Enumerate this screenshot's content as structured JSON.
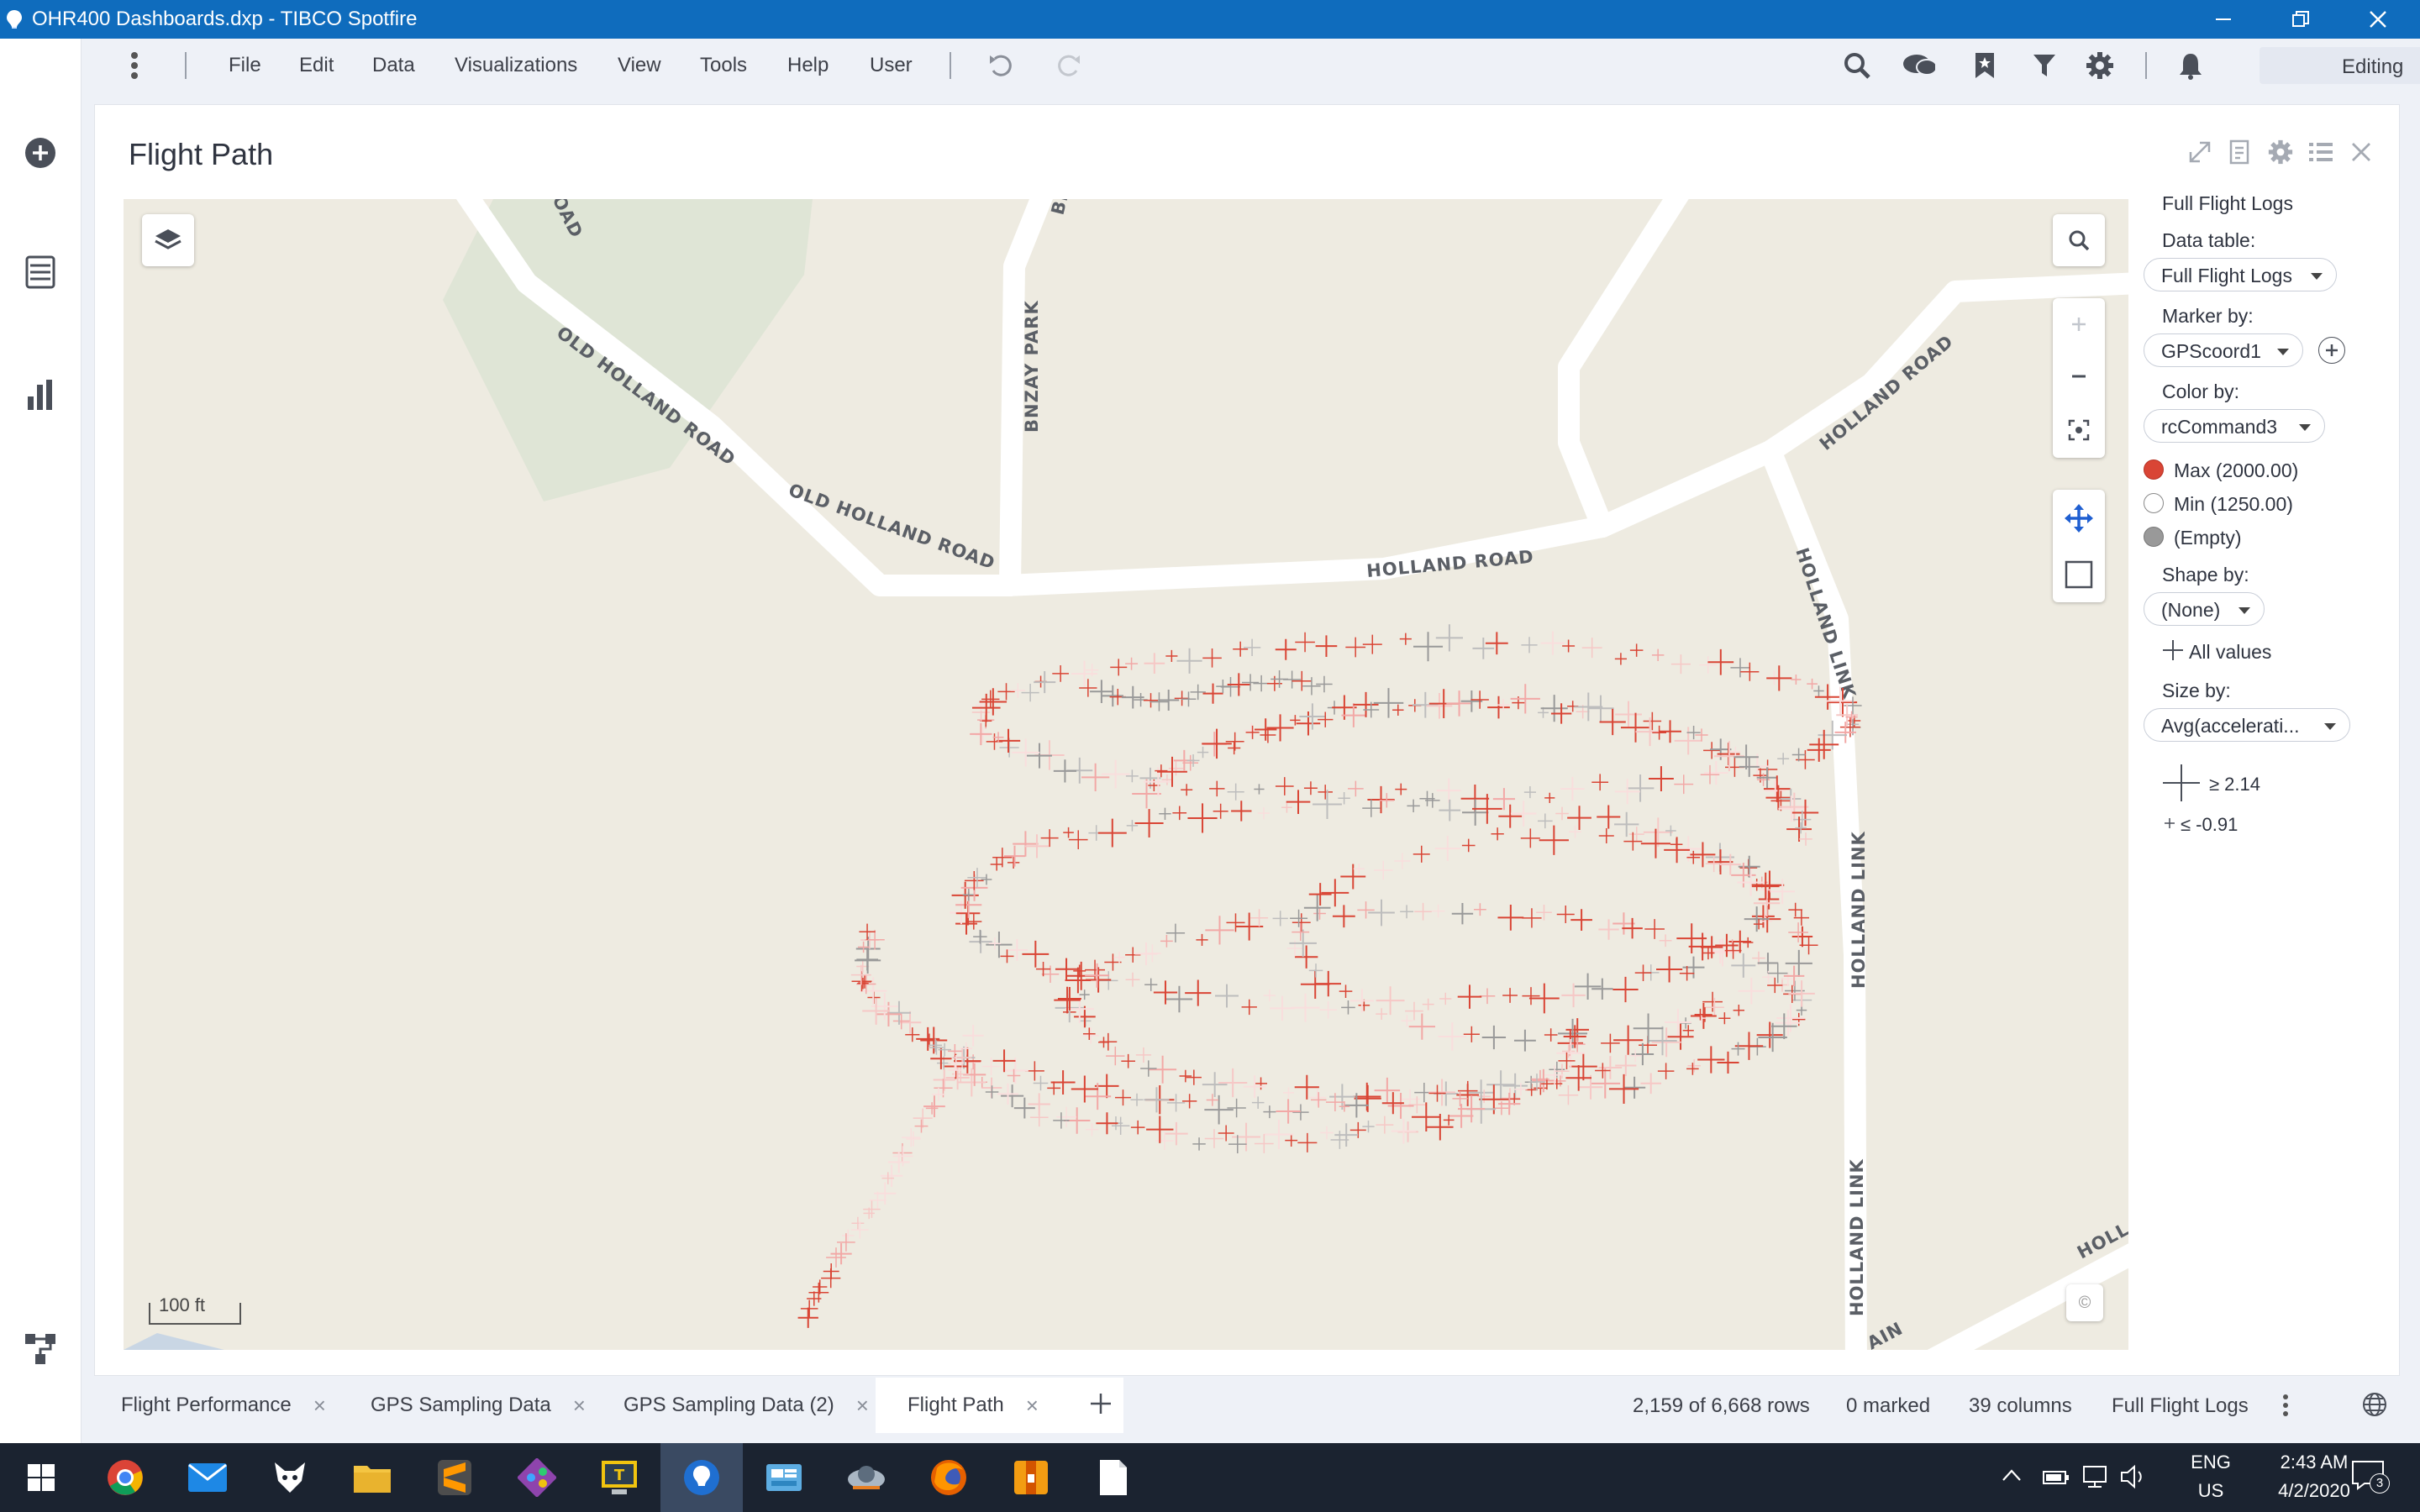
{
  "window": {
    "title": "OHR400 Dashboards.dxp - TIBCO Spotfire"
  },
  "menu": {
    "items": [
      "File",
      "Edit",
      "Data",
      "Visualizations",
      "View",
      "Tools",
      "Help",
      "User"
    ],
    "mode": "Editing"
  },
  "panel": {
    "title": "Flight Path",
    "map": {
      "scale_label": "100 ft",
      "copyright": "©",
      "road_labels": [
        "OLD HOLLAND ROAD",
        "OLD HOLLAND ROAD",
        "HOLLAND ROAD",
        "HOLLAND ROAD",
        "BNZAY PARK",
        "BNZ",
        "HOLLAND LINK",
        "HOLLAND LINK",
        "HOLLAND LINK",
        "OAD",
        "HOLL",
        "AIN"
      ],
      "colors": {
        "max": "#d94535",
        "min": "#ffffff",
        "empty": "#999999",
        "background": "#eeebe1",
        "park": "#dfe5d6",
        "road": "#ffffff"
      }
    },
    "legend": {
      "table_title": "Full Flight Logs",
      "data_table_label": "Data table:",
      "data_table_value": "Full Flight Logs",
      "marker_by_label": "Marker by:",
      "marker_by_value": "GPScoord1",
      "color_by_label": "Color by:",
      "color_by_value": "rcCommand3",
      "color_items": [
        {
          "label": "Max (2000.00)",
          "color": "#d94535"
        },
        {
          "label": "Min (1250.00)",
          "color": "#ffffff"
        },
        {
          "label": "(Empty)",
          "color": "#999999"
        }
      ],
      "shape_by_label": "Shape by:",
      "shape_by_value": "(None)",
      "shape_all_values": "All values",
      "size_by_label": "Size by:",
      "size_by_value": "Avg(accelerati...",
      "size_max": "≥ 2.14",
      "size_min": "≤ -0.91"
    }
  },
  "tabs": [
    {
      "label": "Flight Performance"
    },
    {
      "label": "GPS Sampling Data"
    },
    {
      "label": "GPS Sampling Data (2)"
    },
    {
      "label": "Flight Path",
      "active": true
    }
  ],
  "status": {
    "rows": "2,159 of 6,668 rows",
    "marked": "0 marked",
    "columns": "39 columns",
    "table": "Full Flight Logs"
  },
  "taskbar": {
    "lang": "ENG",
    "region": "US",
    "time": "2:43 AM",
    "date": "4/2/2020",
    "notifications": "3"
  }
}
